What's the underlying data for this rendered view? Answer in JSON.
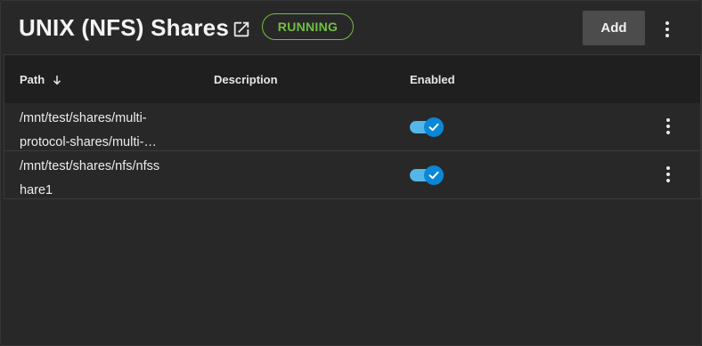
{
  "header": {
    "title": "UNIX (NFS) Shares",
    "status": "RUNNING",
    "add_label": "Add",
    "icons": {
      "open": "open-in-new-icon",
      "menu": "more-vert-icon"
    }
  },
  "table": {
    "columns": [
      {
        "label": "Path",
        "sort": "descending"
      },
      {
        "label": "Description"
      },
      {
        "label": "Enabled"
      }
    ],
    "rows": [
      {
        "path_line1": "/mnt/test/shares/multi-",
        "path_line2": "protocol-shares/multi-…",
        "description": "",
        "enabled": true
      },
      {
        "path_line1": "/mnt/test/shares/nfs/nfss",
        "path_line2": "hare1",
        "description": "",
        "enabled": true
      }
    ]
  },
  "colors": {
    "background": "#282828",
    "header_row": "#1f1f1f",
    "status_green": "#71bf44",
    "toggle_track": "#55b6e8",
    "toggle_knob": "#0a87d6",
    "button_bg": "#4c4c4c"
  }
}
